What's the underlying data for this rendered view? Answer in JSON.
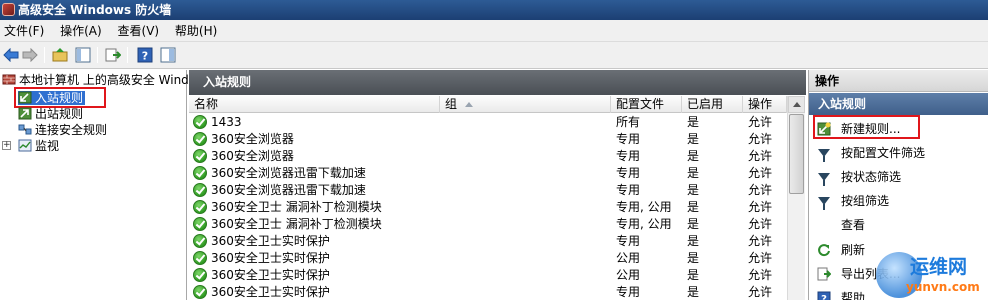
{
  "window": {
    "title": "高级安全 Windows 防火墙"
  },
  "menubar": [
    "文件(F)",
    "操作(A)",
    "查看(V)",
    "帮助(H)"
  ],
  "toolbar": {
    "icons": [
      "back-arrow-icon",
      "forward-arrow-icon",
      "up-folder-icon",
      "show-hide-tree-icon",
      "export-list-icon",
      "help-icon",
      "properties-pane-icon"
    ]
  },
  "tree": {
    "root": "本地计算机 上的高级安全 Windows",
    "items": [
      "入站规则",
      "出站规则",
      "连接安全规则",
      "监视"
    ],
    "expander": "+"
  },
  "center": {
    "title": "入站规则",
    "columns": [
      "名称",
      "组",
      "配置文件",
      "已启用",
      "操作"
    ],
    "rows": [
      {
        "name": "1433",
        "group": "",
        "profile": "所有",
        "enabled": "是",
        "action": "允许"
      },
      {
        "name": "360安全浏览器",
        "group": "",
        "profile": "专用",
        "enabled": "是",
        "action": "允许"
      },
      {
        "name": "360安全浏览器",
        "group": "",
        "profile": "专用",
        "enabled": "是",
        "action": "允许"
      },
      {
        "name": "360安全浏览器迅雷下载加速",
        "group": "",
        "profile": "专用",
        "enabled": "是",
        "action": "允许"
      },
      {
        "name": "360安全浏览器迅雷下载加速",
        "group": "",
        "profile": "专用",
        "enabled": "是",
        "action": "允许"
      },
      {
        "name": "360安全卫士 漏洞补丁检测模块",
        "group": "",
        "profile": "专用, 公用",
        "enabled": "是",
        "action": "允许"
      },
      {
        "name": "360安全卫士 漏洞补丁检测模块",
        "group": "",
        "profile": "专用, 公用",
        "enabled": "是",
        "action": "允许"
      },
      {
        "name": "360安全卫士实时保护",
        "group": "",
        "profile": "专用",
        "enabled": "是",
        "action": "允许"
      },
      {
        "name": "360安全卫士实时保护",
        "group": "",
        "profile": "公用",
        "enabled": "是",
        "action": "允许"
      },
      {
        "name": "360安全卫士实时保护",
        "group": "",
        "profile": "公用",
        "enabled": "是",
        "action": "允许"
      },
      {
        "name": "360安全卫士实时保护",
        "group": "",
        "profile": "专用",
        "enabled": "是",
        "action": "允许"
      }
    ]
  },
  "actions_pane": {
    "header": "操作",
    "section": "入站规则",
    "items": [
      {
        "label": "新建规则...",
        "icon": "new-rule-icon"
      },
      {
        "label": "按配置文件筛选",
        "icon": "filter-icon"
      },
      {
        "label": "按状态筛选",
        "icon": "filter-icon"
      },
      {
        "label": "按组筛选",
        "icon": "filter-icon"
      },
      {
        "label": "查看",
        "icon": ""
      },
      {
        "label": "刷新",
        "icon": "refresh-icon"
      },
      {
        "label": "导出列表...",
        "icon": "export-list-icon"
      },
      {
        "label": "帮助",
        "icon": "help-icon"
      }
    ]
  },
  "watermark": {
    "cn": "运维网",
    "en": "yunvn.com"
  },
  "colors": {
    "highlight_box": "#e0161b",
    "pane_header": "#555a60",
    "action_section": "#4a6b96"
  }
}
